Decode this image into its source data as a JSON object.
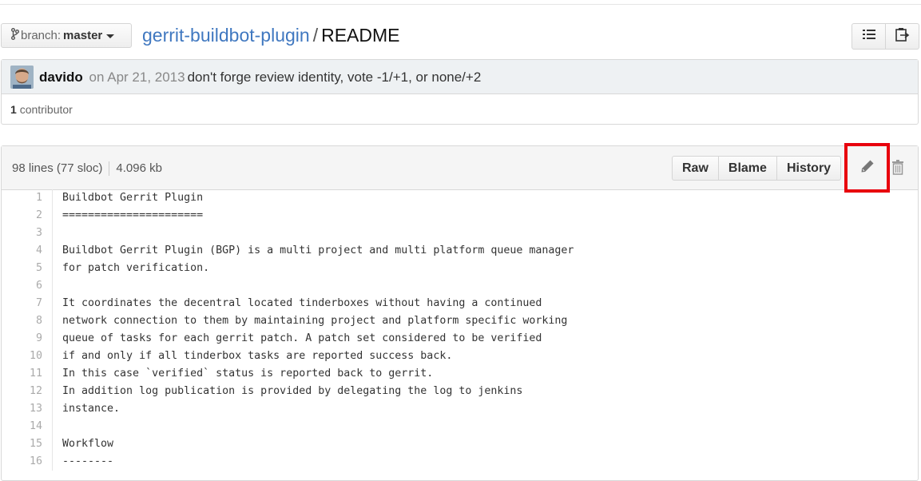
{
  "branch": {
    "prefix": "branch:",
    "name": "master"
  },
  "path": {
    "repo": "gerrit-buildbot-plugin",
    "separator": "/",
    "file": "README"
  },
  "header_icons": [
    "list-icon",
    "clipboard-icon"
  ],
  "commit": {
    "author": "davido",
    "date": "on Apr 21, 2013",
    "message": "don't forge review identity, vote -1/+1, or none/+2"
  },
  "contributors": {
    "count": "1",
    "label": "contributor"
  },
  "file": {
    "lines_info": "98 lines (77 sloc)",
    "size": "4.096 kb",
    "buttons": {
      "raw": "Raw",
      "blame": "Blame",
      "history": "History"
    },
    "action_icons": [
      "pencil-icon",
      "trash-icon"
    ],
    "highlight_color": "#e8000d"
  },
  "code_lines": [
    {
      "n": "1",
      "text": "Buildbot Gerrit Plugin"
    },
    {
      "n": "2",
      "text": "======================"
    },
    {
      "n": "3",
      "text": ""
    },
    {
      "n": "4",
      "text": "Buildbot Gerrit Plugin (BGP) is a multi project and multi platform queue manager"
    },
    {
      "n": "5",
      "text": "for patch verification."
    },
    {
      "n": "6",
      "text": ""
    },
    {
      "n": "7",
      "text": "It coordinates the decentral located tinderboxes without having a continued"
    },
    {
      "n": "8",
      "text": "network connection to them by maintaining project and platform specific working"
    },
    {
      "n": "9",
      "text": "queue of tasks for each gerrit patch. A patch set considered to be verified"
    },
    {
      "n": "10",
      "text": "if and only if all tinderbox tasks are reported success back."
    },
    {
      "n": "11",
      "text": "In this case `verified` status is reported back to gerrit."
    },
    {
      "n": "12",
      "text": "In addition log publication is provided by delegating the log to jenkins"
    },
    {
      "n": "13",
      "text": "instance."
    },
    {
      "n": "14",
      "text": ""
    },
    {
      "n": "15",
      "text": "Workflow"
    },
    {
      "n": "16",
      "text": "--------"
    }
  ]
}
